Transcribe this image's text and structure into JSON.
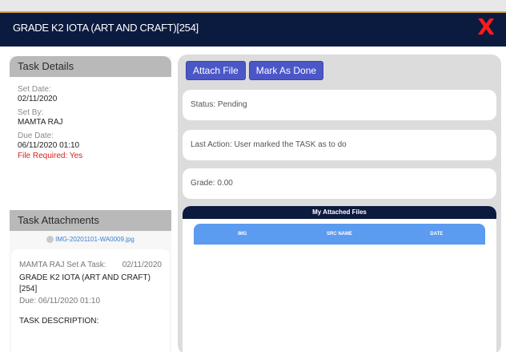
{
  "window": {
    "title": "GRADE K2 IOTA (ART AND CRAFT)[254]",
    "close_glyph": "X"
  },
  "task_details": {
    "heading": "Task Details",
    "set_date_label": "Set Date:",
    "set_date": "02/11/2020",
    "set_by_label": "Set By:",
    "set_by": "MAMTA RAJ",
    "due_date_label": "Due Date:",
    "due_date": "06/11/2020 01:10",
    "file_required": "File Required: Yes"
  },
  "task_attachments": {
    "heading": "Task Attachments",
    "file_name": "IMG-20201101-WA0009.jpg",
    "card": {
      "set_line": "MAMTA RAJ Set A Task:",
      "date": "02/11/2020",
      "task_name": "GRADE K2 IOTA (ART AND CRAFT) [254]",
      "due": "Due: 06/11/2020 01:10",
      "description_label": "TASK DESCRIPTION:"
    }
  },
  "actions": {
    "attach_file": "Attach File",
    "mark_as_done": "Mark As Done"
  },
  "status": {
    "status_text": "Status: Pending",
    "last_action": "Last Action: User marked the TASK as to do",
    "grade": "Grade: 0.00"
  },
  "attached_files": {
    "heading": "My Attached Files",
    "columns": [
      "IMG",
      "SRC NAME",
      "DATE"
    ]
  },
  "colors": {
    "titlebar": "#0b1a3f",
    "close": "#ff1b1b",
    "button": "#4b57c7",
    "table_header": "#5b9bf0",
    "required": "#d42020"
  }
}
